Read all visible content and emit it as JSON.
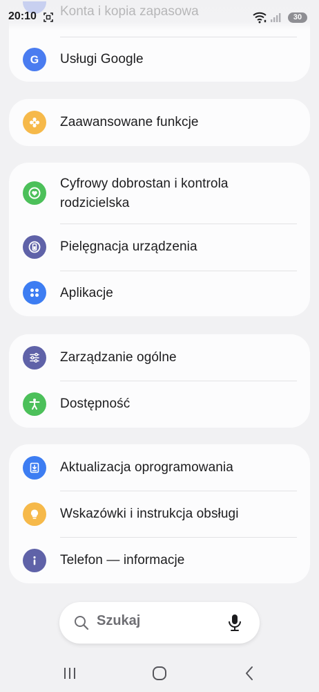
{
  "status_bar": {
    "time": "20:10",
    "battery": "30"
  },
  "top_partial_row": {
    "label": "Konta i kopia zapasowa"
  },
  "cards": [
    {
      "rows": [
        {
          "label": "Usługi Google",
          "icon": "google-icon",
          "color": "#4a7cf0"
        }
      ]
    },
    {
      "rows": [
        {
          "label": "Zaawansowane funkcje",
          "icon": "advanced-features-icon",
          "color": "#f6b94a"
        }
      ]
    },
    {
      "rows": [
        {
          "label": "Cyfrowy dobrostan i kontrola rodzicielska",
          "icon": "digital-wellbeing-icon",
          "color": "#4cc05a"
        },
        {
          "label": "Pielęgnacja urządzenia",
          "icon": "device-care-icon",
          "color": "#5f62a8"
        },
        {
          "label": "Aplikacje",
          "icon": "apps-icon",
          "color": "#3d7df2"
        }
      ]
    },
    {
      "rows": [
        {
          "label": "Zarządzanie ogólne",
          "icon": "general-management-icon",
          "color": "#5f62a8"
        },
        {
          "label": "Dostępność",
          "icon": "accessibility-icon",
          "color": "#4cc05a"
        }
      ]
    },
    {
      "rows": [
        {
          "label": "Aktualizacja oprogramowania",
          "icon": "software-update-icon",
          "color": "#3d7df2"
        },
        {
          "label": "Wskazówki i instrukcja obsługi",
          "icon": "tips-bulb-icon",
          "color": "#f6b94a"
        },
        {
          "label": "Telefon — informacje",
          "icon": "info-icon",
          "color": "#5f62a8"
        }
      ]
    }
  ],
  "search": {
    "placeholder": "Szukaj"
  }
}
